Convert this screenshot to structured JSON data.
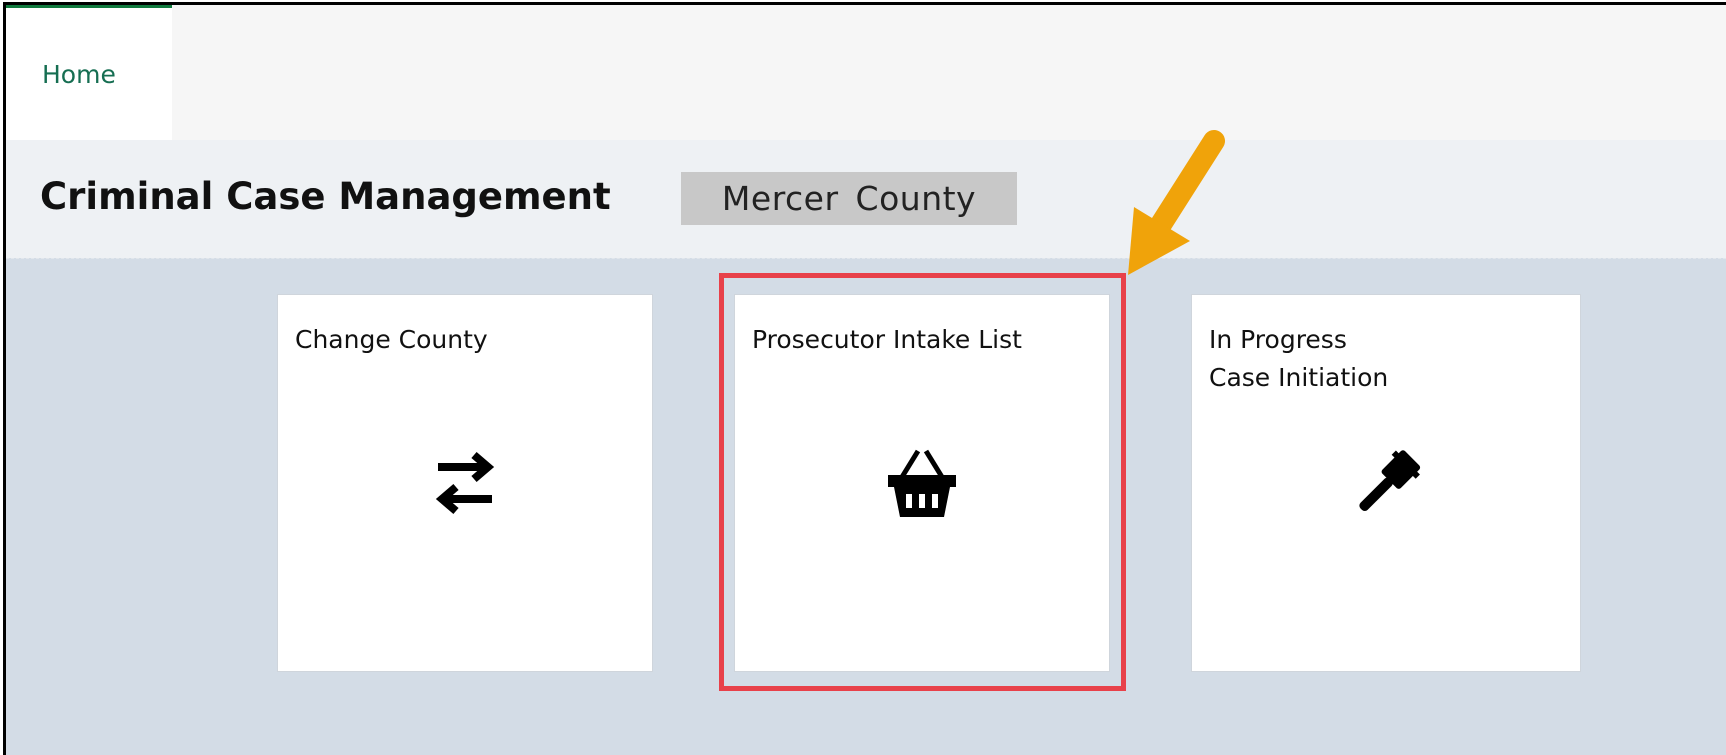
{
  "nav": {
    "tabs": [
      {
        "label": "Home"
      }
    ]
  },
  "header": {
    "title": "Criminal Case Management",
    "county": "Mercer  County"
  },
  "tiles": [
    {
      "label": "Change County",
      "icon": "swap-arrows-icon"
    },
    {
      "label": "Prosecutor Intake List",
      "icon": "basket-icon"
    },
    {
      "label": "In Progress\nCase Initiation",
      "icon": "gavel-icon"
    }
  ],
  "annotation": {
    "highlight_color": "#e8414a",
    "arrow_color": "#f0a30a"
  },
  "colors": {
    "accent": "#117a3e",
    "home_tab_text": "#166e52",
    "tile_area_bg": "#d3dce6"
  }
}
